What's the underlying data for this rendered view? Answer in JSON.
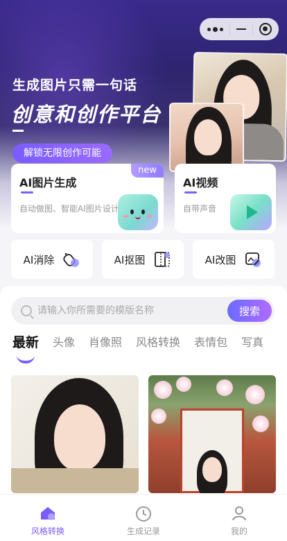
{
  "hero": {
    "subtitle": "生成图片只需一句话",
    "title": "创意和创作平台",
    "unlock_button": "解锁无限创作可能"
  },
  "capsule": {
    "menu_icon": "more-dots-icon",
    "minimize_icon": "minus-icon",
    "close_icon": "record-icon"
  },
  "feature_cards": [
    {
      "title": "AI图片生成",
      "desc": "自动做图、智能AI图片设计",
      "badge": "new"
    },
    {
      "title": "AI视频",
      "desc": "自带声音"
    }
  ],
  "tools": [
    {
      "label": "AI消除",
      "icon": "eraser-icon"
    },
    {
      "label": "AI抠图",
      "icon": "cutout-icon"
    },
    {
      "label": "AI改图",
      "icon": "edit-image-icon"
    }
  ],
  "search": {
    "placeholder": "请输入你所需要的模版名称",
    "button": "搜索"
  },
  "tabs": [
    "最新",
    "头像",
    "肖像照",
    "风格转换",
    "表情包",
    "写真"
  ],
  "active_tab": "最新",
  "bottom_nav": [
    {
      "label": "风格转换",
      "icon": "home-icon",
      "active": true
    },
    {
      "label": "生成记录",
      "icon": "clock-icon",
      "active": false
    },
    {
      "label": "我的",
      "icon": "user-icon",
      "active": false
    }
  ],
  "colors": {
    "accent": "#7a5cff",
    "hero_bg": "#2e2470"
  }
}
